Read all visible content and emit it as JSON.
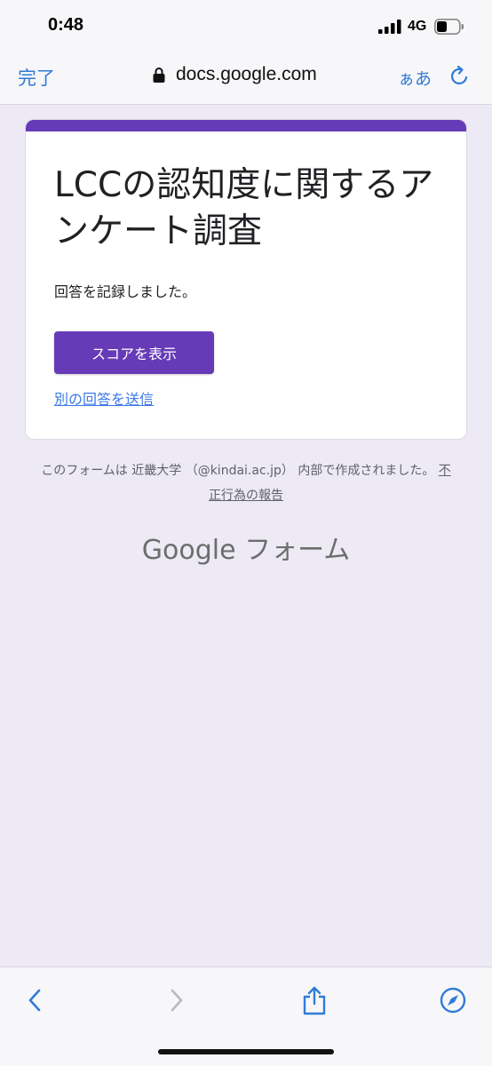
{
  "status_bar": {
    "time": "0:48",
    "network": "4G"
  },
  "nav": {
    "done_label": "完了",
    "url": "docs.google.com",
    "text_size_label": "ぁあ"
  },
  "form": {
    "title": "LCCの認知度に関するアンケート調査",
    "confirmation": "回答を記録しました。",
    "score_button": "スコアを表示",
    "another_response_link": "別の回答を送信"
  },
  "footer": {
    "note": "このフォームは 近畿大学 （@kindai.ac.jp） 内部で作成されました。",
    "abuse_link": "不正行為の報告",
    "logo_text": "Google フォーム"
  },
  "colors": {
    "accent": "#673ab7",
    "background": "#edeaf5",
    "link": "#3b78e7",
    "ios_blue": "#2f7bd8"
  }
}
